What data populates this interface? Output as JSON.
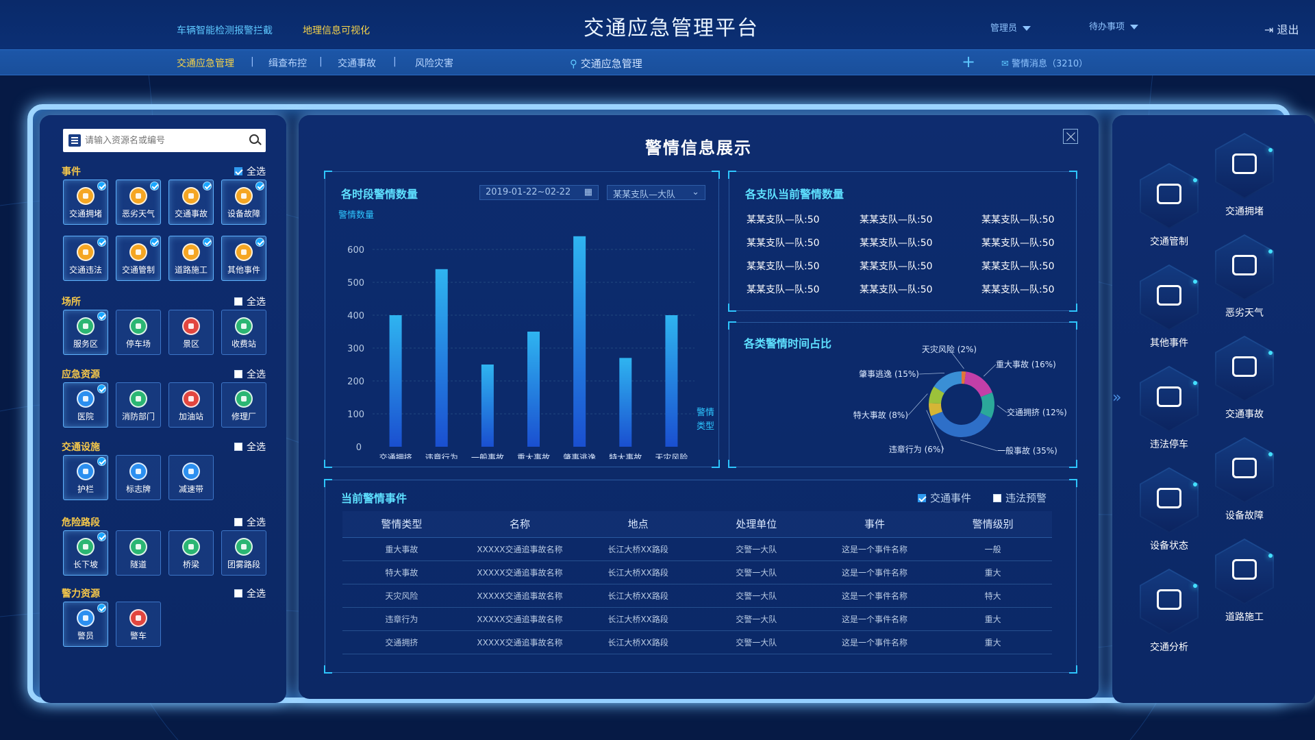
{
  "header": {
    "title": "交通应急管理平台",
    "top_links": [
      "车辆智能检测报警拦截",
      "地理信息可视化"
    ],
    "user": "管理员",
    "todo": "待办事项",
    "logout": "退出"
  },
  "nav": {
    "items": [
      "交通应急管理",
      "缉查布控",
      "交通事故",
      "风险灾害"
    ],
    "location": "交通应急管理",
    "plus": "+",
    "messages": "警情消息（3210）"
  },
  "left": {
    "search_placeholder": "请输入资源名或编号",
    "sections": [
      {
        "title": "事件",
        "select_all": "全选",
        "checked": true,
        "items": [
          {
            "label": "交通拥堵",
            "icon": "traffic-jam-icon",
            "color": "o",
            "checked": true
          },
          {
            "label": "恶劣天气",
            "icon": "bad-weather-icon",
            "color": "o",
            "checked": true
          },
          {
            "label": "交通事故",
            "icon": "accident-icon",
            "color": "o",
            "checked": true
          },
          {
            "label": "设备故障",
            "icon": "device-fault-icon",
            "color": "o",
            "checked": true
          },
          {
            "label": "交通违法",
            "icon": "violation-icon",
            "color": "o",
            "checked": true
          },
          {
            "label": "交通管制",
            "icon": "traffic-control-icon",
            "color": "o",
            "checked": true
          },
          {
            "label": "道路施工",
            "icon": "road-work-icon",
            "color": "o",
            "checked": true
          },
          {
            "label": "其他事件",
            "icon": "other-event-icon",
            "color": "o",
            "checked": true
          }
        ]
      },
      {
        "title": "场所",
        "select_all": "全选",
        "checked": false,
        "items": [
          {
            "label": "服务区",
            "icon": "service-area-icon",
            "color": "g",
            "checked": true
          },
          {
            "label": "停车场",
            "icon": "parking-icon",
            "color": "g",
            "checked": false
          },
          {
            "label": "景区",
            "icon": "scenic-icon",
            "color": "r",
            "checked": false
          },
          {
            "label": "收费站",
            "icon": "toll-station-icon",
            "color": "g",
            "checked": false
          }
        ]
      },
      {
        "title": "应急资源",
        "select_all": "全选",
        "checked": false,
        "items": [
          {
            "label": "医院",
            "icon": "hospital-icon",
            "color": "b",
            "checked": true
          },
          {
            "label": "消防部门",
            "icon": "fire-dept-icon",
            "color": "g",
            "checked": false
          },
          {
            "label": "加油站",
            "icon": "gas-station-icon",
            "color": "r",
            "checked": false
          },
          {
            "label": "修理厂",
            "icon": "repair-shop-icon",
            "color": "g",
            "checked": false
          }
        ]
      },
      {
        "title": "交通设施",
        "select_all": "全选",
        "checked": false,
        "items": [
          {
            "label": "护栏",
            "icon": "guardrail-icon",
            "color": "b",
            "checked": true
          },
          {
            "label": "标志牌",
            "icon": "signboard-icon",
            "color": "b",
            "checked": false
          },
          {
            "label": "减速带",
            "icon": "speed-bump-icon",
            "color": "b",
            "checked": false
          }
        ]
      },
      {
        "title": "危险路段",
        "select_all": "全选",
        "checked": false,
        "items": [
          {
            "label": "长下坡",
            "icon": "downhill-icon",
            "color": "g",
            "checked": true
          },
          {
            "label": "隧道",
            "icon": "tunnel-icon",
            "color": "g",
            "checked": false
          },
          {
            "label": "桥梁",
            "icon": "bridge-icon",
            "color": "g",
            "checked": false
          },
          {
            "label": "团雾路段",
            "icon": "fog-road-icon",
            "color": "g",
            "checked": false
          }
        ]
      },
      {
        "title": "警力资源",
        "select_all": "全选",
        "checked": false,
        "items": [
          {
            "label": "警员",
            "icon": "police-officer-icon",
            "color": "b",
            "checked": true
          },
          {
            "label": "警车",
            "icon": "police-car-icon",
            "color": "r",
            "checked": false
          }
        ]
      }
    ]
  },
  "center": {
    "title": "警情信息展示",
    "bar": {
      "title": "各时段警情数量",
      "date_range": "2019-01-22~02-22",
      "team_select": "某某支队—大队"
    },
    "teams": {
      "title": "各支队当前警情数量",
      "items": [
        "某某支队—队:50",
        "某某支队—队:50",
        "某某支队—队:50",
        "某某支队—队:50",
        "某某支队—队:50",
        "某某支队—队:50",
        "某某支队—队:50",
        "某某支队—队:50",
        "某某支队—队:50",
        "某某支队—队:50",
        "某某支队—队:50",
        "某某支队—队:50"
      ]
    },
    "donut_title": "各类警情时间占比",
    "events": {
      "title": "当前警情事件",
      "filters": [
        {
          "label": "交通事件",
          "checked": true
        },
        {
          "label": "违法预警",
          "checked": false
        }
      ],
      "columns": [
        "警情类型",
        "名称",
        "地点",
        "处理单位",
        "事件",
        "警情级别"
      ],
      "rows": [
        [
          "重大事故",
          "XXXXX交通追事故名称",
          "长江大桥XX路段",
          "交警一大队",
          "这是一个事件名称",
          "一般"
        ],
        [
          "特大事故",
          "XXXXX交通追事故名称",
          "长江大桥XX路段",
          "交警一大队",
          "这是一个事件名称",
          "重大"
        ],
        [
          "天灾风险",
          "XXXXX交通追事故名称",
          "长江大桥XX路段",
          "交警一大队",
          "这是一个事件名称",
          "特大"
        ],
        [
          "违章行为",
          "XXXXX交通追事故名称",
          "长江大桥XX路段",
          "交警一大队",
          "这是一个事件名称",
          "重大"
        ],
        [
          "交通拥挤",
          "XXXXX交通追事故名称",
          "长江大桥XX路段",
          "交警一大队",
          "这是一个事件名称",
          "重大"
        ]
      ]
    }
  },
  "right": {
    "expand_glyph": "»",
    "tools": [
      {
        "label": "交通管制",
        "icon": "traffic-control-icon"
      },
      {
        "label": "交通拥堵",
        "icon": "traffic-jam-icon"
      },
      {
        "label": "其他事件",
        "icon": "other-event-icon"
      },
      {
        "label": "恶劣天气",
        "icon": "bad-weather-icon"
      },
      {
        "label": "违法停车",
        "icon": "no-parking-icon"
      },
      {
        "label": "交通事故",
        "icon": "accident-icon"
      },
      {
        "label": "设备状态",
        "icon": "device-status-icon"
      },
      {
        "label": "设备故障",
        "icon": "device-fault-icon"
      },
      {
        "label": "交通分析",
        "icon": "traffic-analysis-icon"
      },
      {
        "label": "道路施工",
        "icon": "road-work-icon"
      }
    ]
  },
  "chart_data": [
    {
      "type": "bar",
      "title": "各时段警情数量",
      "ylabel": "警情数量",
      "xlabel": "警情类型",
      "ylim": [
        0,
        650
      ],
      "yticks": [
        0,
        100,
        200,
        300,
        400,
        500,
        600
      ],
      "categories": [
        "交通拥挤",
        "违章行为",
        "一般事故",
        "重大事故",
        "肇事逃逸",
        "特大事故",
        "天灾风险"
      ],
      "values": [
        400,
        540,
        250,
        350,
        640,
        270,
        400
      ],
      "colors": {
        "top": "#2fb4f0",
        "bottom": "#1a4fd0"
      }
    },
    {
      "type": "pie",
      "title": "各类警情时间占比",
      "slices": [
        {
          "label": "天灾风险",
          "value": 2,
          "display": "天灾风险 (2%)",
          "color": "#e0763a"
        },
        {
          "label": "重大事故",
          "value": 16,
          "display": "重大事故 (16%)",
          "color": "#c23fa8"
        },
        {
          "label": "交通拥挤",
          "value": 12,
          "display": "交通拥挤 (12%)",
          "color": "#2ba89a"
        },
        {
          "label": "一般事故",
          "value": 35,
          "display": "一般事故 (35%)",
          "color": "#2e6fc8"
        },
        {
          "label": "违章行为",
          "value": 6,
          "display": "违章行为 (6%)",
          "color": "#d5b536"
        },
        {
          "label": "特大事故",
          "value": 8,
          "display": "特大事故 (8%)",
          "color": "#9cc23a"
        },
        {
          "label": "肇事逃逸",
          "value": 15,
          "display": "肇事逃逸 (15%)",
          "color": "#3a8fd5"
        }
      ]
    }
  ]
}
